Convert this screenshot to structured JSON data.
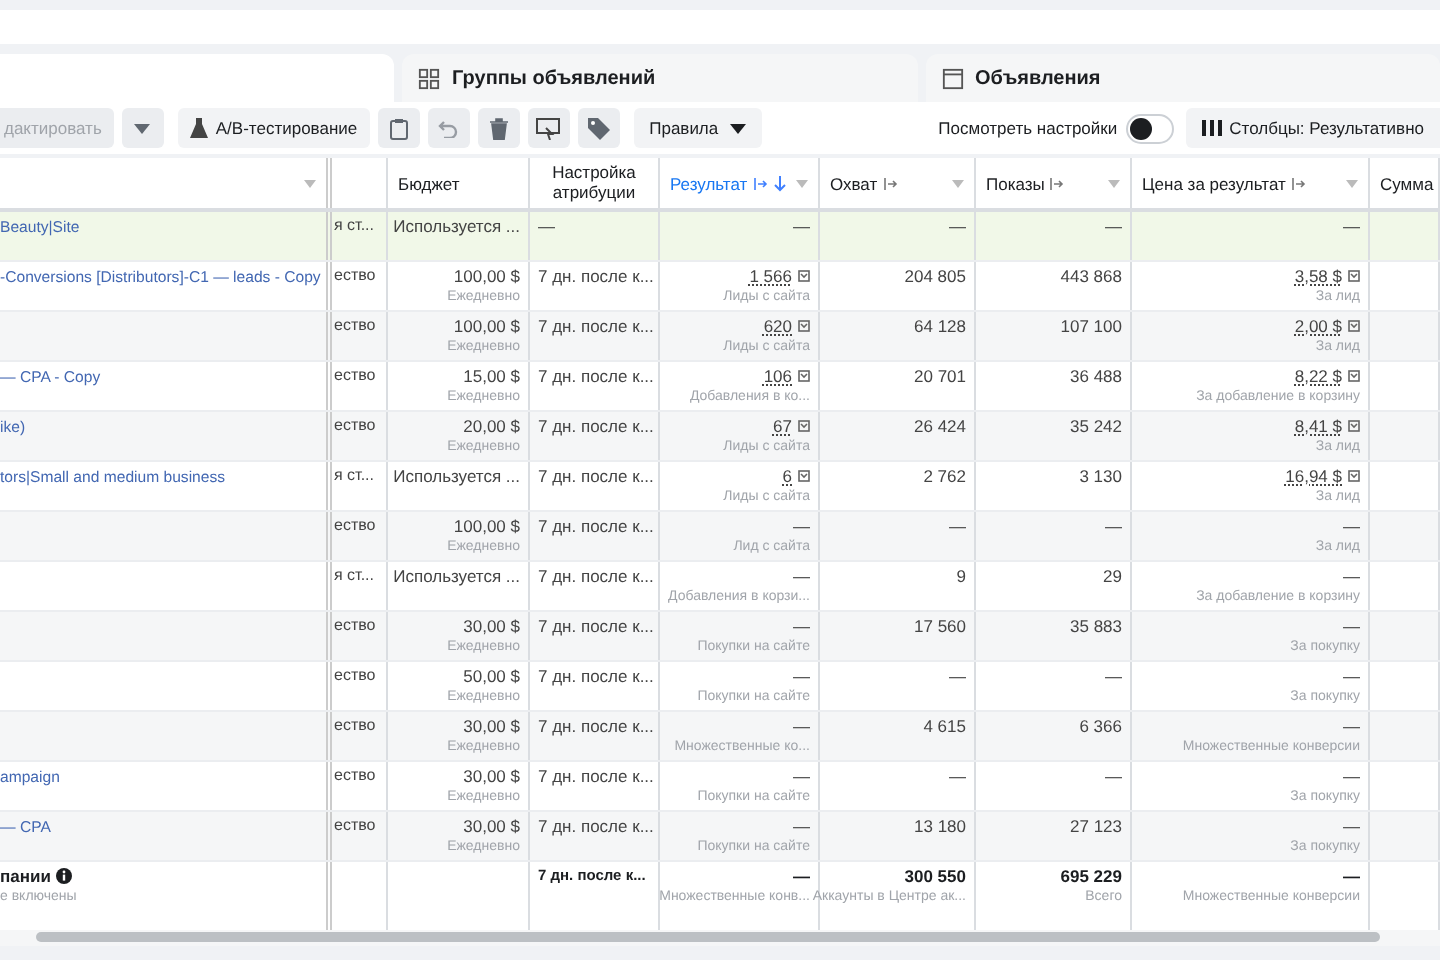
{
  "tabs": [
    {
      "label": "Группы объявлений",
      "kind": "adsets"
    },
    {
      "label": "Объявления",
      "kind": "ads"
    }
  ],
  "toolbar": [
    {
      "kind": "edit",
      "label": "дактировать",
      "disabled": true
    },
    {
      "kind": "dropdown",
      "disabled": false
    },
    {
      "kind": "ab_test",
      "label": "A/B-тестирование",
      "disabled": false
    },
    {
      "kind": "duplicate",
      "disabled": false
    },
    {
      "kind": "undo",
      "disabled": true
    },
    {
      "kind": "delete",
      "disabled": false
    },
    {
      "kind": "preview",
      "disabled": false
    },
    {
      "kind": "tags",
      "disabled": false
    },
    {
      "kind": "rules",
      "label": "Правила",
      "disabled": false
    }
  ],
  "view_settings": {
    "label": "Посмотреть настройки",
    "on": false
  },
  "columns_button": {
    "label": "Столбцы: Результативно"
  },
  "columns": [
    {
      "kind": "name",
      "sorted": false
    },
    {
      "kind": "delivery",
      "sorted": false
    },
    {
      "kind": "budget",
      "label": "Бюджет",
      "sorted": false
    },
    {
      "kind": "attribution",
      "label": "Настройка атрибуции",
      "sorted": false
    },
    {
      "kind": "result",
      "label": "Результат",
      "sorted": true
    },
    {
      "kind": "reach",
      "label": "Охват",
      "sorted": false
    },
    {
      "kind": "impressions",
      "label": "Показы",
      "sorted": false
    },
    {
      "kind": "cost",
      "label": "Цена за результат",
      "sorted": false
    },
    {
      "kind": "sum",
      "label": "Сумма",
      "sorted": false
    }
  ],
  "rows": [
    {
      "highlighted": true,
      "name": "Beauty|Site",
      "delivery": "я ст...",
      "budget": {
        "amount": "Используется ..."
      },
      "attribution": "—",
      "result": {
        "value": "—",
        "detailed": false
      },
      "reach": "—",
      "impressions": "—",
      "cost": {
        "value": "—",
        "detailed": false
      }
    },
    {
      "highlighted": false,
      "name": "-Conversions [Distributors]-C1 — leads - Copy",
      "delivery": "ество",
      "budget": {
        "amount": "100,00 $",
        "period": "Ежедневно"
      },
      "attribution": "7 дн. после к...",
      "result": {
        "value": "1 566",
        "note": "Лиды с сайта",
        "detailed": true
      },
      "reach": "204 805",
      "impressions": "443 868",
      "cost": {
        "value": "3,58 $",
        "note": "За лид",
        "detailed": true
      }
    },
    {
      "highlighted": false,
      "delivery": "ество",
      "budget": {
        "amount": "100,00 $",
        "period": "Ежедневно"
      },
      "attribution": "7 дн. после к...",
      "result": {
        "value": "620",
        "note": "Лиды с сайта",
        "detailed": true
      },
      "reach": "64 128",
      "impressions": "107 100",
      "cost": {
        "value": "2,00 $",
        "note": "За лид",
        "detailed": true
      }
    },
    {
      "highlighted": false,
      "name": "— CPA - Copy",
      "delivery": "ество",
      "budget": {
        "amount": "15,00 $",
        "period": "Ежедневно"
      },
      "attribution": "7 дн. после к...",
      "result": {
        "value": "106",
        "note": "Добавления в ко...",
        "detailed": true
      },
      "reach": "20 701",
      "impressions": "36 488",
      "cost": {
        "value": "8,22 $",
        "note": "За добавление в корзину",
        "detailed": true
      }
    },
    {
      "highlighted": false,
      "name": "ike)",
      "delivery": "ество",
      "budget": {
        "amount": "20,00 $",
        "period": "Ежедневно"
      },
      "attribution": "7 дн. после к...",
      "result": {
        "value": "67",
        "note": "Лиды с сайта",
        "detailed": true
      },
      "reach": "26 424",
      "impressions": "35 242",
      "cost": {
        "value": "8,41 $",
        "note": "За лид",
        "detailed": true
      }
    },
    {
      "highlighted": false,
      "name": "tors|Small and medium business",
      "delivery": "я ст...",
      "budget": {
        "amount": "Используется ..."
      },
      "attribution": "7 дн. после к...",
      "result": {
        "value": "6",
        "note": "Лиды с сайта",
        "detailed": true
      },
      "reach": "2 762",
      "impressions": "3 130",
      "cost": {
        "value": "16,94 $",
        "note": "За лид",
        "detailed": true
      }
    },
    {
      "highlighted": false,
      "delivery": "ество",
      "budget": {
        "amount": "100,00 $",
        "period": "Ежедневно"
      },
      "attribution": "7 дн. после к...",
      "result": {
        "value": "—",
        "note": "Лид с сайта",
        "detailed": false
      },
      "reach": "—",
      "impressions": "—",
      "cost": {
        "value": "—",
        "note": "За лид",
        "detailed": false
      }
    },
    {
      "highlighted": false,
      "delivery": "я ст...",
      "budget": {
        "amount": "Используется ..."
      },
      "attribution": "7 дн. после к...",
      "result": {
        "value": "—",
        "note": "Добавления в корзи...",
        "detailed": false
      },
      "reach": "9",
      "impressions": "29",
      "cost": {
        "value": "—",
        "note": "За добавление в корзину",
        "detailed": false
      }
    },
    {
      "highlighted": false,
      "delivery": "ество",
      "budget": {
        "amount": "30,00 $",
        "period": "Ежедневно"
      },
      "attribution": "7 дн. после к...",
      "result": {
        "value": "—",
        "note": "Покупки на сайте",
        "detailed": false
      },
      "reach": "17 560",
      "impressions": "35 883",
      "cost": {
        "value": "—",
        "note": "За покупку",
        "detailed": false
      }
    },
    {
      "highlighted": false,
      "delivery": "ество",
      "budget": {
        "amount": "50,00 $",
        "period": "Ежедневно"
      },
      "attribution": "7 дн. после к...",
      "result": {
        "value": "—",
        "note": "Покупки на сайте",
        "detailed": false
      },
      "reach": "—",
      "impressions": "—",
      "cost": {
        "value": "—",
        "note": "За покупку",
        "detailed": false
      }
    },
    {
      "highlighted": false,
      "delivery": "ество",
      "budget": {
        "amount": "30,00 $",
        "period": "Ежедневно"
      },
      "attribution": "7 дн. после к...",
      "result": {
        "value": "—",
        "note": "Множественные ко...",
        "detailed": false
      },
      "reach": "4 615",
      "impressions": "6 366",
      "cost": {
        "value": "—",
        "note": "Множественные конверсии",
        "detailed": false
      }
    },
    {
      "highlighted": false,
      "name": "ampaign",
      "delivery": "ество",
      "budget": {
        "amount": "30,00 $",
        "period": "Ежедневно"
      },
      "attribution": "7 дн. после к...",
      "result": {
        "value": "—",
        "note": "Покупки на сайте",
        "detailed": false
      },
      "reach": "—",
      "impressions": "—",
      "cost": {
        "value": "—",
        "note": "За покупку",
        "detailed": false
      }
    },
    {
      "highlighted": false,
      "name": "— CPA",
      "delivery": "ество",
      "budget": {
        "amount": "30,00 $",
        "period": "Ежедневно"
      },
      "attribution": "7 дн. после к...",
      "result": {
        "value": "—",
        "note": "Покупки на сайте",
        "detailed": false
      },
      "reach": "13 180",
      "impressions": "27 123",
      "cost": {
        "value": "—",
        "note": "За покупку",
        "detailed": false
      }
    }
  ],
  "total": {
    "name": "пании",
    "note": "е включены",
    "attribution": "7 дн. после к...",
    "result": {
      "value": "—",
      "note": "Множественные конв..."
    },
    "reach": {
      "value": "300 550",
      "note": "Аккаунты в Центре ак..."
    },
    "impressions": {
      "value": "695 229",
      "note": "Всего"
    },
    "cost": {
      "value": "—",
      "note": "Множественные конверсии"
    }
  }
}
